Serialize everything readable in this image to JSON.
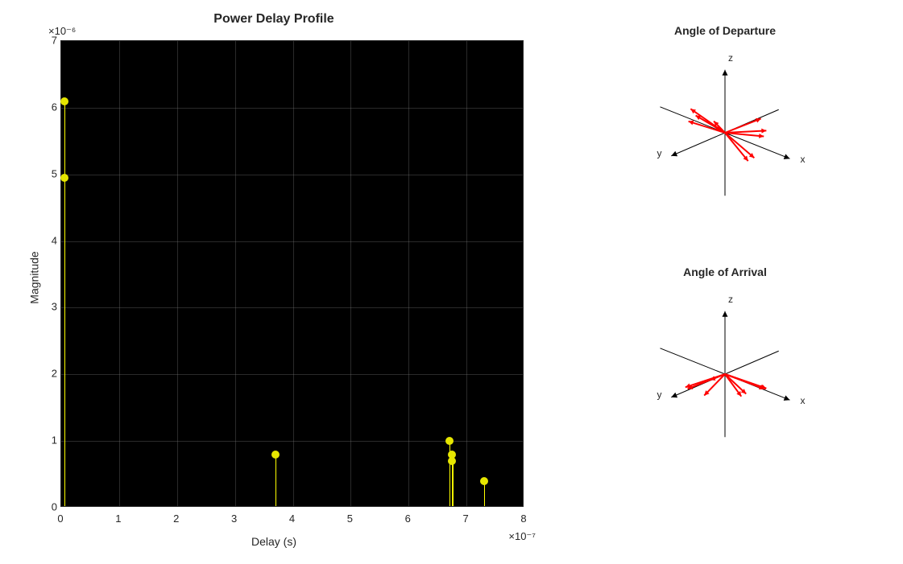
{
  "chart_data": [
    {
      "type": "bar",
      "id": "pdp",
      "title": "Power Delay Profile",
      "xlabel": "Delay (s)",
      "ylabel": "Magnitude",
      "xexp_label": "×10⁻⁷",
      "yexp_label": "×10⁻⁶",
      "xlim": [
        0,
        8
      ],
      "ylim": [
        0,
        7
      ],
      "xticks": [
        0,
        1,
        2,
        3,
        4,
        5,
        6,
        7,
        8
      ],
      "yticks": [
        0,
        1,
        2,
        3,
        4,
        5,
        6,
        7
      ],
      "xtick_labels": [
        "0",
        "1",
        "2",
        "3",
        "4",
        "5",
        "6",
        "7",
        "8"
      ],
      "ytick_labels": [
        "0",
        "1",
        "2",
        "3",
        "4",
        "5",
        "6",
        "7"
      ],
      "categories_note": "x in 1e-7 s, values in 1e-6",
      "x": [
        0.05,
        0.05,
        3.7,
        6.7,
        6.75,
        6.75,
        7.3
      ],
      "values": [
        6.1,
        4.95,
        0.8,
        1.0,
        0.8,
        0.7,
        0.4
      ],
      "marker_color": "#e6e600",
      "stem_color": "#ffff00",
      "bg_color": "#000000"
    },
    {
      "type": "quiver3d",
      "id": "aod",
      "title": "Angle of Departure",
      "axis_labels": {
        "x": "x",
        "y": "y",
        "z": "z"
      },
      "vectors_note": "unit vectors [x,y,z] approximated from plot",
      "vectors": [
        [
          0.85,
          -0.45,
          0.25
        ],
        [
          0.9,
          -0.3,
          0.15
        ],
        [
          0.4,
          -0.8,
          0.3
        ],
        [
          -0.5,
          0.7,
          0.4
        ],
        [
          -0.85,
          0.2,
          0.45
        ],
        [
          -0.95,
          -0.1,
          0.1
        ],
        [
          0.0,
          0.4,
          0.5
        ],
        [
          0.15,
          0.55,
          0.45
        ],
        [
          0.7,
          -0.2,
          -0.55
        ],
        [
          0.6,
          -0.1,
          -0.65
        ]
      ],
      "color": "#ff0000"
    },
    {
      "type": "quiver3d",
      "id": "aoa",
      "title": "Angle of Arrival",
      "axis_labels": {
        "x": "x",
        "y": "y",
        "z": "z"
      },
      "vectors_note": "unit vectors [x,y,z] approximated from plot",
      "vectors": [
        [
          0.95,
          -0.25,
          -0.15
        ],
        [
          0.9,
          -0.35,
          -0.2
        ],
        [
          -0.4,
          0.85,
          -0.3
        ],
        [
          -0.55,
          0.75,
          -0.35
        ],
        [
          0.85,
          -0.45,
          -0.25
        ],
        [
          0.8,
          -0.5,
          -0.3
        ],
        [
          -0.2,
          0.5,
          -0.55
        ],
        [
          -0.6,
          -0.2,
          -0.5
        ],
        [
          0.5,
          -0.15,
          -0.45
        ],
        [
          0.4,
          -0.1,
          -0.55
        ]
      ],
      "color": "#ff0000"
    }
  ]
}
